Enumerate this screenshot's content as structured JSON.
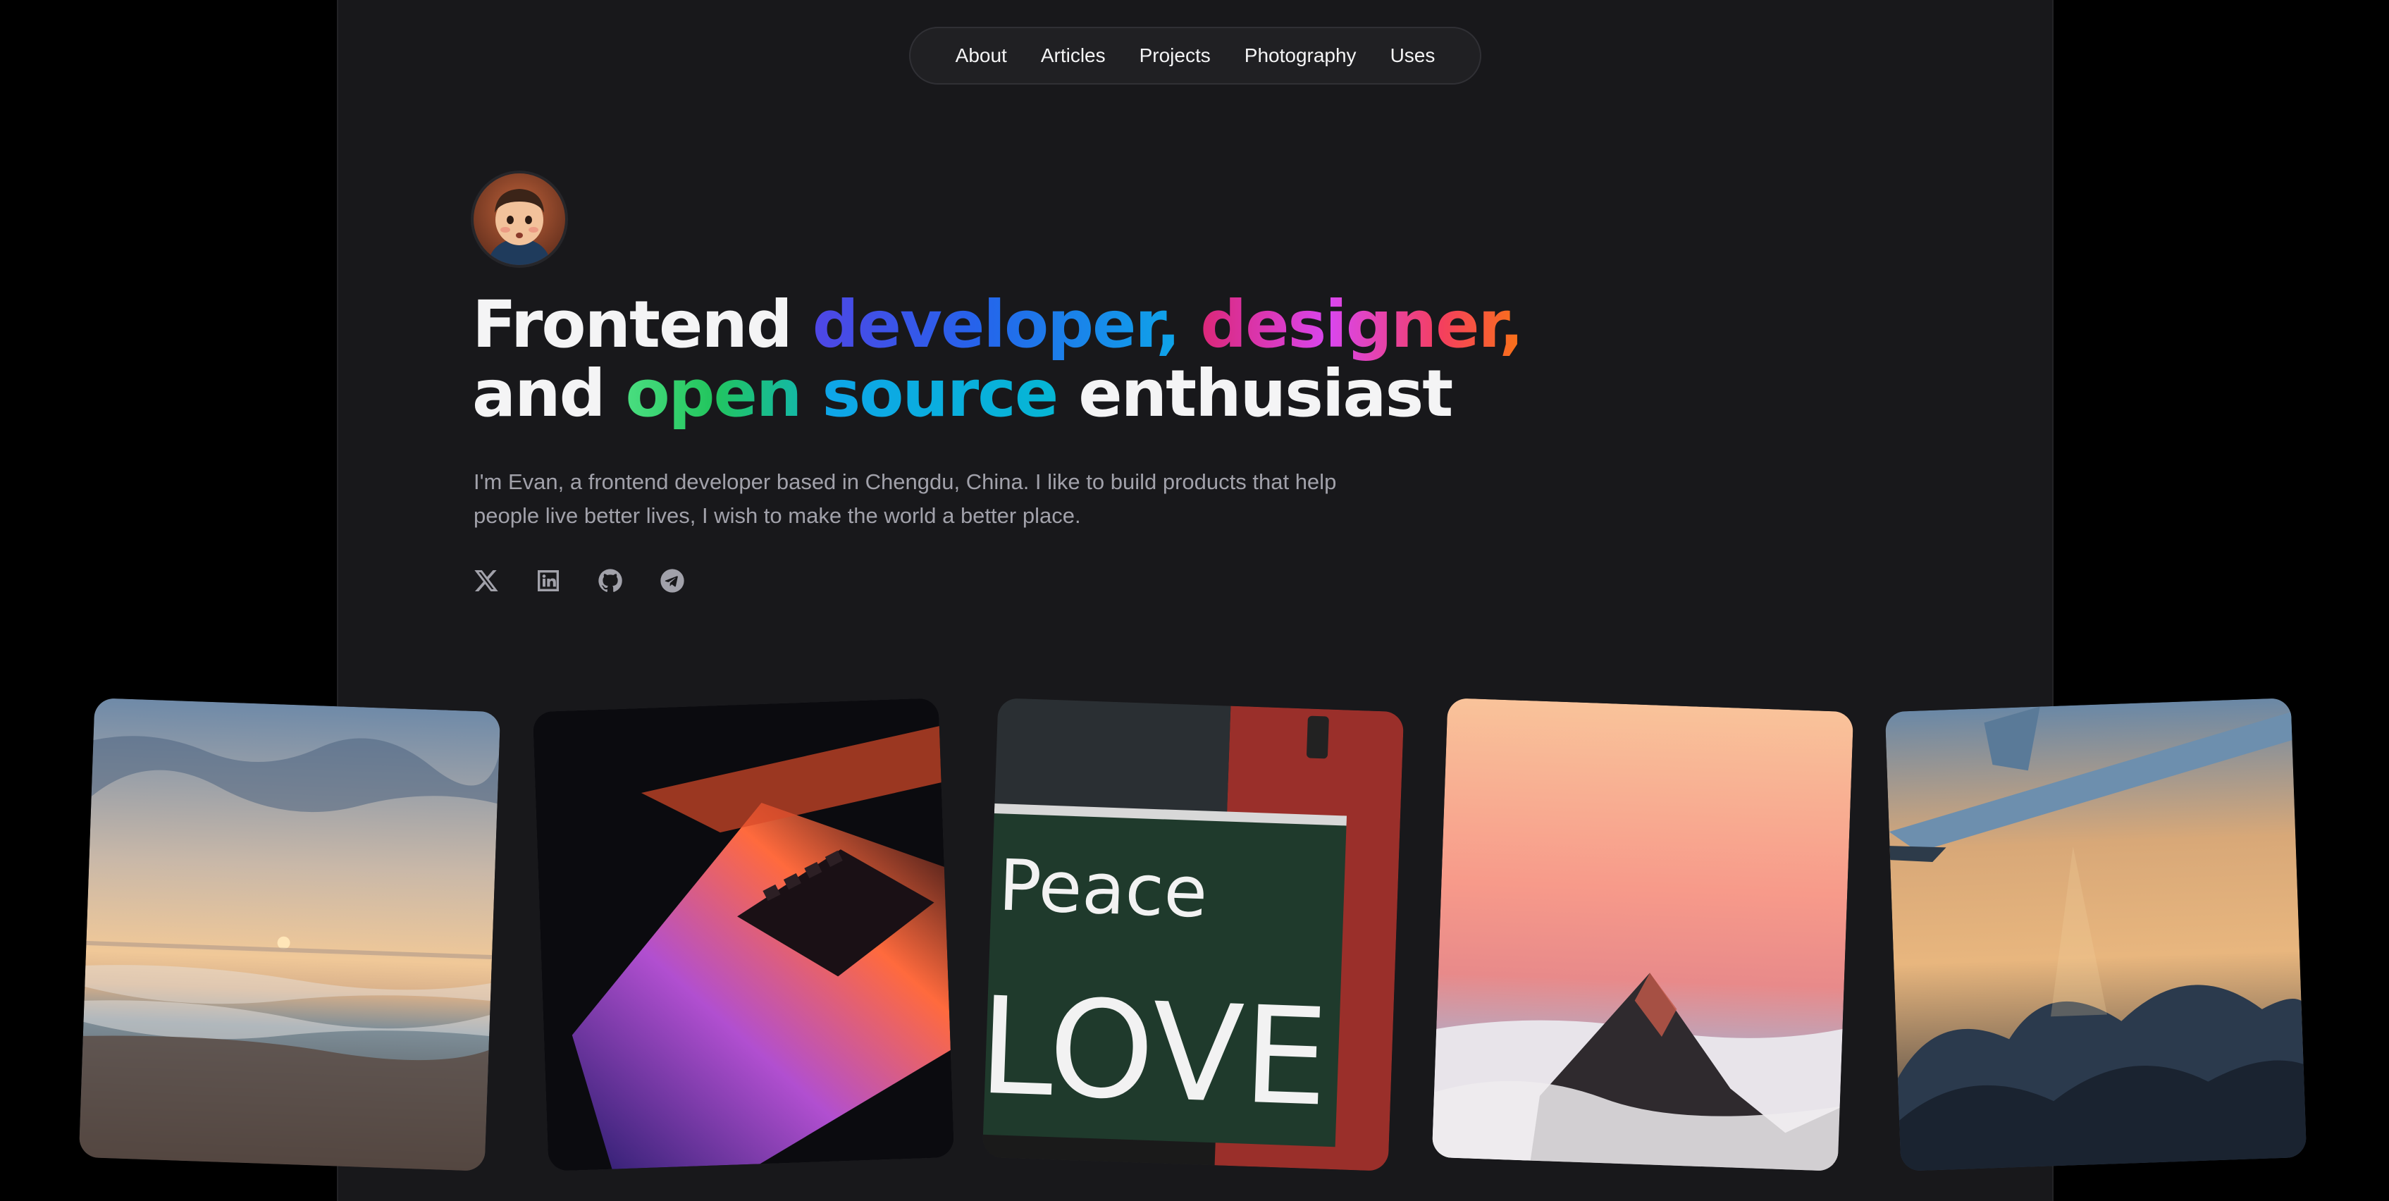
{
  "nav": {
    "items": [
      {
        "label": "About"
      },
      {
        "label": "Articles"
      },
      {
        "label": "Projects"
      },
      {
        "label": "Photography"
      },
      {
        "label": "Uses"
      }
    ]
  },
  "hero": {
    "line1_plain": "Frontend ",
    "line1_grad1": "developer,",
    "line1_space": " ",
    "line1_grad2": "designer,",
    "line2_plain1": "and ",
    "line2_grad1": "open",
    "line2_space": " ",
    "line2_grad2": "source",
    "line2_plain2": " enthusiast",
    "bio_line1": "I'm Evan, a frontend developer based in Chengdu, China. I like to build products that help",
    "bio_line2": "people live better lives, I wish to make the world a better place."
  },
  "socials": [
    {
      "icon": "x-icon"
    },
    {
      "icon": "linkedin-icon"
    },
    {
      "icon": "github-icon"
    },
    {
      "icon": "telegram-icon"
    }
  ],
  "photos": [
    {
      "subject": "sunset over ocean beach"
    },
    {
      "subject": "laptop keyboard with purple glow"
    },
    {
      "subject": "peace love graffiti wall"
    },
    {
      "subject": "mountain peak above clouds at sunset"
    },
    {
      "subject": "airplane wing above clouds"
    }
  ],
  "colors": {
    "page_bg": "#000000",
    "column_bg": "#18181b",
    "text": "#f4f4f5",
    "muted": "#a1a1aa"
  }
}
